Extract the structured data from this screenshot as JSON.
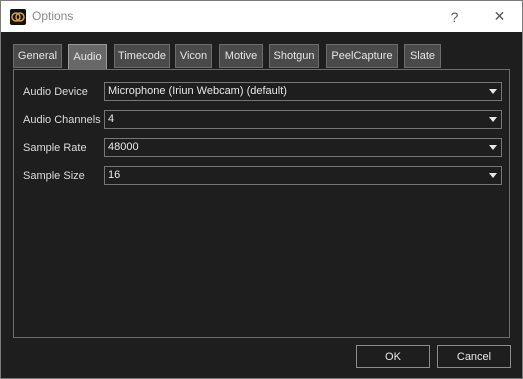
{
  "window": {
    "title": "Options",
    "help_glyph": "?",
    "close_glyph": "✕",
    "icon": "app-logo-icon"
  },
  "tabs": [
    {
      "label": "General",
      "active": false
    },
    {
      "label": "Audio",
      "active": true
    },
    {
      "label": "Timecode",
      "active": false
    },
    {
      "label": "Vicon",
      "active": false
    },
    {
      "label": "Motive",
      "active": false
    },
    {
      "label": "Shotgun",
      "active": false
    },
    {
      "label": "PeelCapture",
      "active": false
    },
    {
      "label": "Slate",
      "active": false
    }
  ],
  "audio": {
    "device_label": "Audio Device",
    "device_value": "Microphone (Iriun Webcam) (default)",
    "channels_label": "Audio Channels",
    "channels_value": "4",
    "rate_label": "Sample Rate",
    "rate_value": "48000",
    "size_label": "Sample Size",
    "size_value": "16"
  },
  "buttons": {
    "ok": "OK",
    "cancel": "Cancel"
  },
  "colors": {
    "background": "#1e1e1e",
    "tab": "#4a4a4a",
    "tab_active": "#686868",
    "titlebar": "#ffffff"
  }
}
